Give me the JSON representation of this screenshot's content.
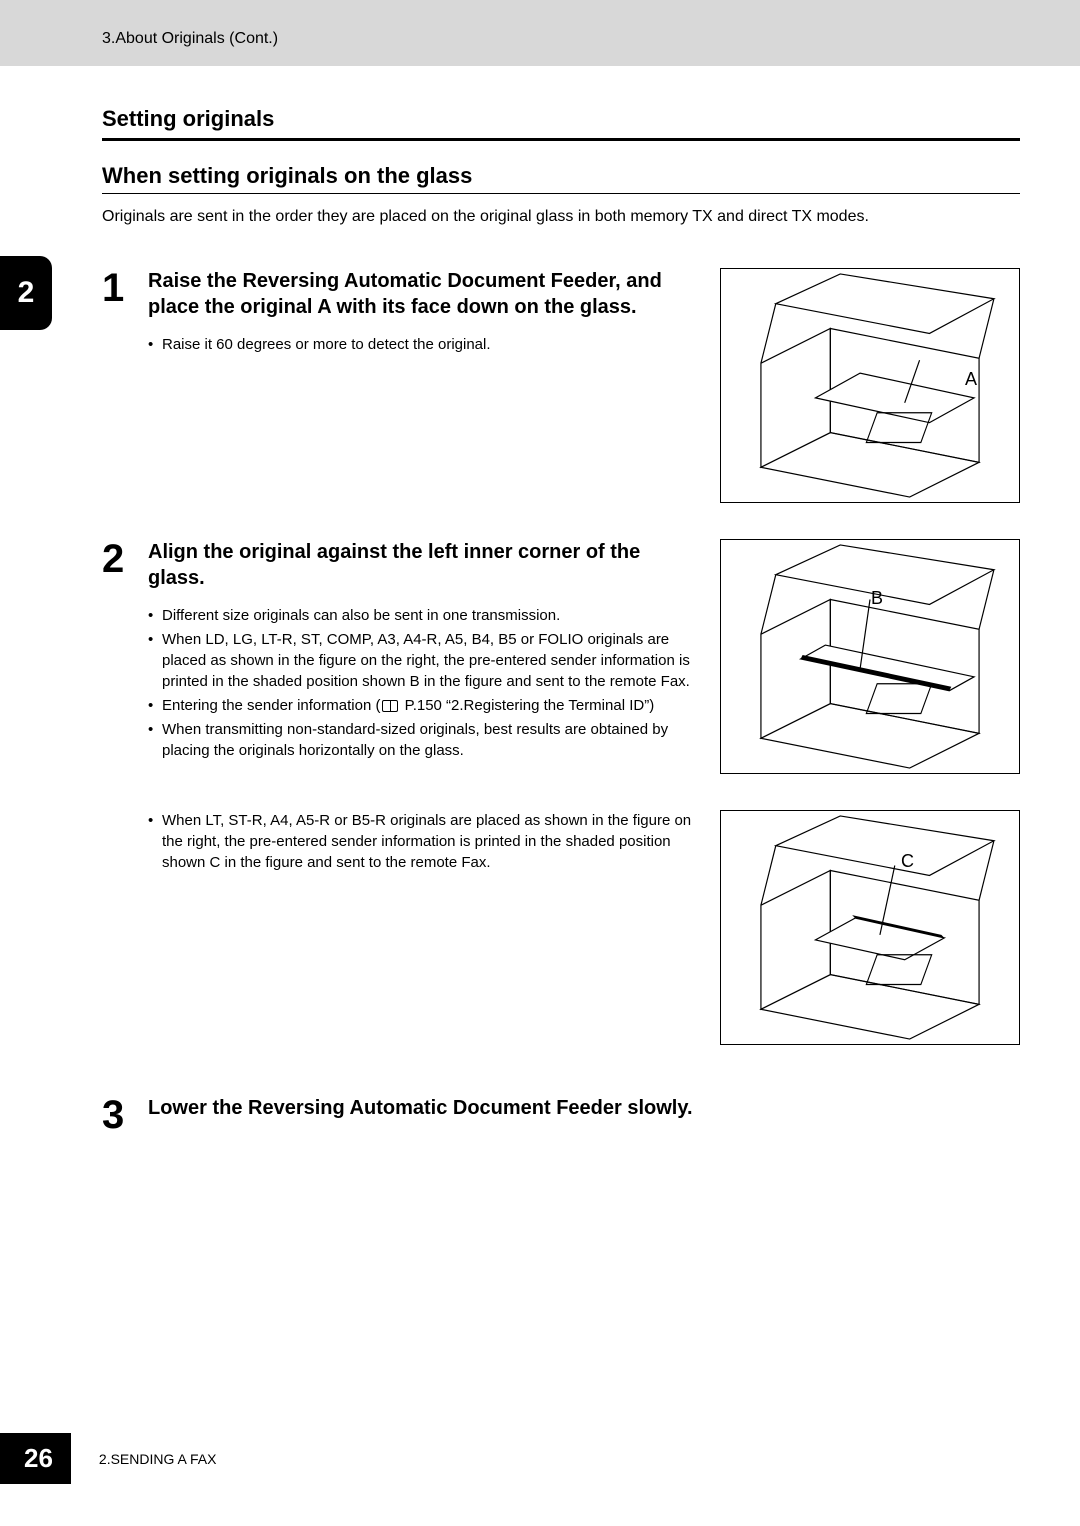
{
  "header": {
    "breadcrumb": "3.About Originals (Cont.)"
  },
  "chapter_tab": "2",
  "section": {
    "title": "Setting originals",
    "subtitle": "When setting originals on the glass",
    "intro": "Originals are sent in the order they are placed on the original glass in both memory TX and direct TX modes."
  },
  "steps": [
    {
      "num": "1",
      "heading": "Raise the Reversing Automatic Document Feeder, and place the original A with its face down on the glass.",
      "bullets": [
        "Raise it 60 degrees or more to detect the original."
      ],
      "label": "A"
    },
    {
      "num": "2",
      "heading": "Align the original against the left inner corner of the glass.",
      "bullets": [
        "Different size originals can also be sent in one transmission.",
        "When LD, LG, LT-R, ST, COMP, A3, A4-R, A5, B4, B5 or FOLIO originals are placed as shown in the figure on the right, the pre-entered sender information is printed in the shaded position shown B in the figure and sent to the remote Fax.",
        "Entering the sender information ( 📖 P.150 “2.Registering the Terminal ID”)",
        "When transmitting non-standard-sized originals, best results are obtained by placing the originals horizontally on the glass."
      ],
      "label": "B"
    },
    {
      "num": "3",
      "heading": "Lower the Reversing Automatic Document Feeder slowly."
    }
  ],
  "extra": {
    "bullets": [
      "When LT, ST-R, A4, A5-R or B5-R originals are placed as shown in the figure on the right, the pre-entered sender information is printed in the shaded position shown C in the figure and sent to the remote Fax."
    ],
    "label": "C"
  },
  "footer": {
    "page": "26",
    "chapter": "2.SENDING A FAX"
  }
}
